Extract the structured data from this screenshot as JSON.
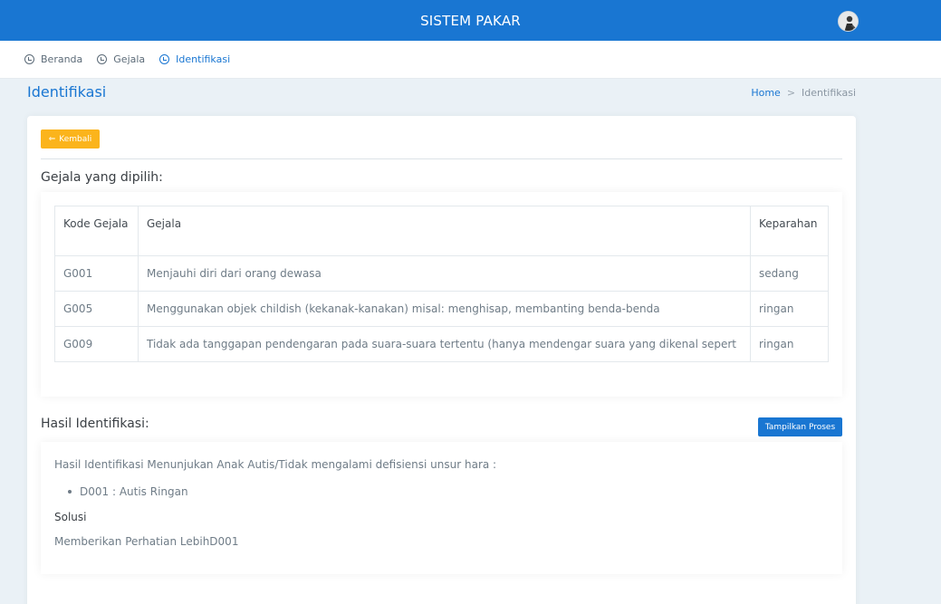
{
  "app": {
    "title": "SISTEM PAKAR"
  },
  "nav": {
    "items": [
      {
        "label": "Beranda",
        "active": false
      },
      {
        "label": "Gejala",
        "active": false
      },
      {
        "label": "Identifikasi",
        "active": true
      }
    ]
  },
  "page": {
    "title": "Identifikasi",
    "breadcrumb": {
      "home": "Home",
      "separator": ">",
      "current": "Identifikasi"
    }
  },
  "back_button": {
    "label": "Kembali",
    "icon": "arrow-left-icon"
  },
  "symptoms": {
    "title": "Gejala yang dipilih:",
    "headers": {
      "kode": "Kode Gejala",
      "gejala": "Gejala",
      "keparahan": "Keparahan"
    },
    "rows": [
      {
        "kode": "G001",
        "gejala": "Menjauhi diri dari orang dewasa",
        "keparahan": "sedang"
      },
      {
        "kode": "G005",
        "gejala": "Menggunakan objek childish (kekanak-kanakan) misal: menghisap, membanting benda-benda",
        "keparahan": "ringan"
      },
      {
        "kode": "G009",
        "gejala": "Tidak ada tanggapan pendengaran pada suara-suara tertentu (hanya mendengar suara yang dikenal sepert",
        "keparahan": "ringan"
      }
    ]
  },
  "result": {
    "title": "Hasil Identifikasi:",
    "show_process_label": "Tampilkan Proses",
    "intro": "Hasil Identifikasi Menunjukan Anak Autis/Tidak mengalami defisiensi unsur hara :",
    "diagnosis": "D001 : Autis Ringan",
    "solution_label": "Solusi",
    "solution": "Memberikan Perhatian LebihD001"
  },
  "colors": {
    "primary": "#1976d2",
    "warning": "#fbb41c",
    "background": "#eaf1f6"
  }
}
